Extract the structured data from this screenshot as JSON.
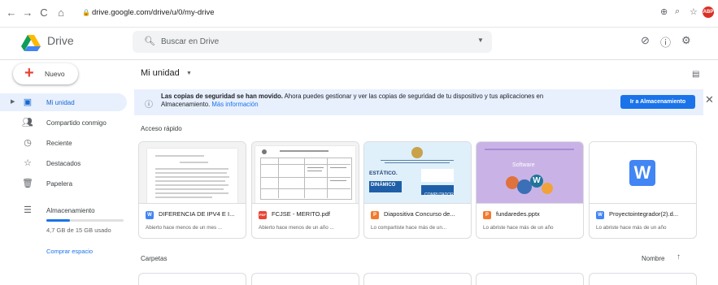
{
  "browser": {
    "url": "drive.google.com/drive/u/0/my-drive",
    "extension_badge": "ABP"
  },
  "app": {
    "name": "Drive",
    "search_placeholder": "Buscar en Drive"
  },
  "sidebar": {
    "new_label": "Nuevo",
    "items": [
      {
        "label": "Mi unidad",
        "icon": "drive-icon",
        "active": true
      },
      {
        "label": "Compartido conmigo",
        "icon": "people-icon"
      },
      {
        "label": "Reciente",
        "icon": "clock-icon"
      },
      {
        "label": "Destacados",
        "icon": "star-icon"
      },
      {
        "label": "Papelera",
        "icon": "trash-icon"
      },
      {
        "label": "Almacenamiento",
        "icon": "storage-icon"
      }
    ],
    "storage_text": "4,7 GB de 15 GB usado",
    "storage_fraction": 0.31,
    "buy_label": "Comprar espacio"
  },
  "main": {
    "title": "Mi unidad",
    "banner": {
      "bold": "Las copias de seguridad se han movido.",
      "text": " Ahora puedes gestionar y ver las copias de seguridad de tu dispositivo y tus aplicaciones en Almacenamiento. ",
      "link": "Más información",
      "button": "Ir a Almacenamiento"
    },
    "quick_access_label": "Acceso rápido",
    "files": [
      {
        "name": "DIFERENCIA DE IPV4 E I...",
        "meta": "Abierto hace menos de un mes ...",
        "type": "W",
        "color": "#4285f4"
      },
      {
        "name": "FCJSE - MERITO.pdf",
        "meta": "Abierto hace menos de un año ...",
        "type": "PDF",
        "color": "#ea4335"
      },
      {
        "name": "Diapositiva Concurso de...",
        "meta": "Lo compartiste hace más de un...",
        "type": "P",
        "color": "#f4792b"
      },
      {
        "name": "fundaredes.pptx",
        "meta": "Lo abriste hace más de un año",
        "type": "P",
        "color": "#f4792b"
      },
      {
        "name": "Proyectointegrador(2).d...",
        "meta": "Lo abriste hace más de un año",
        "type": "W",
        "color": "#4285f4"
      }
    ],
    "thumb_text": {
      "slide1_line1": "ESTÁTICO.",
      "slide1_line2": "DINÁMICO",
      "slide1_side": "COMPUTADOR",
      "slide2_title": "Software"
    },
    "folders_label": "Carpetas",
    "sort_label": "Nombre"
  }
}
